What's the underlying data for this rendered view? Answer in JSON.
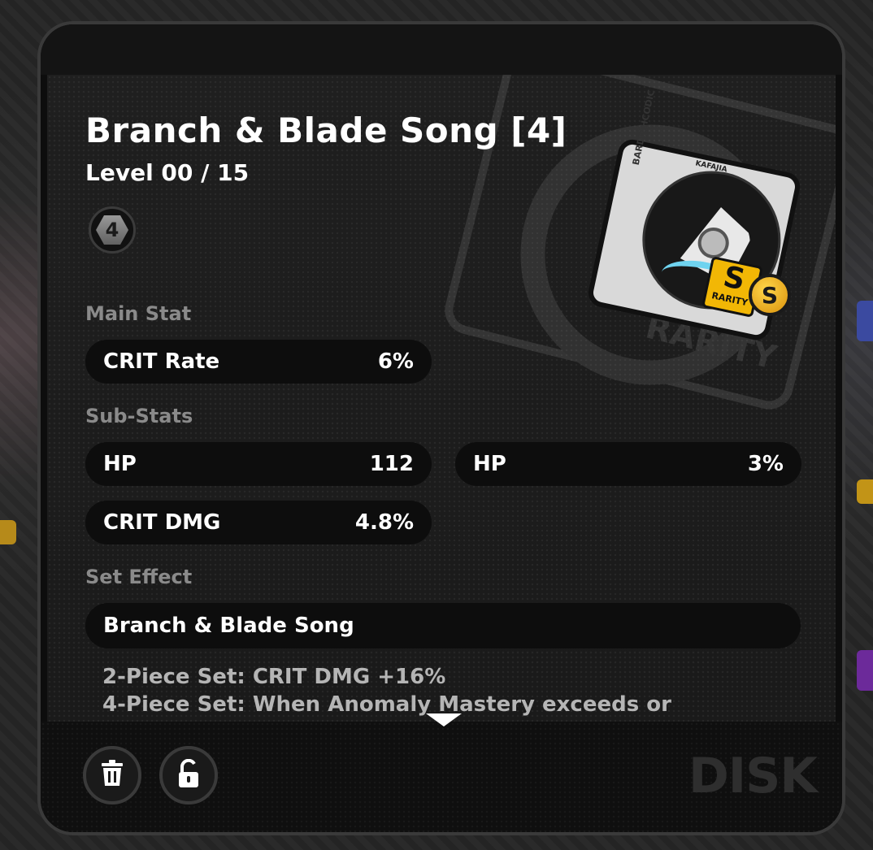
{
  "item": {
    "title": "Branch & Blade Song [4]",
    "level": "Level 00 / 15",
    "slot": "4",
    "rarity": "S"
  },
  "disk_art": {
    "spine_text": "BARDICHCODIC",
    "top_text": "KAFAJIA",
    "rarity_letter": "S",
    "rarity_word": "RARITY"
  },
  "main_stat": {
    "heading": "Main Stat",
    "name": "CRIT Rate",
    "value": "6%"
  },
  "sub_stats": {
    "heading": "Sub-Stats",
    "items": [
      {
        "name": "HP",
        "value": "112"
      },
      {
        "name": "HP",
        "value": "3%"
      },
      {
        "name": "CRIT DMG",
        "value": "4.8%"
      }
    ]
  },
  "set_effect": {
    "heading": "Set Effect",
    "name": "Branch & Blade Song",
    "line1": "2-Piece Set: CRIT DMG +16%",
    "line2": "4-Piece Set: When Anomaly Mastery exceeds or"
  },
  "footer": {
    "category": "DISK",
    "buttons": [
      "trash-icon",
      "unlock-icon"
    ]
  },
  "colors": {
    "accent_gold": "#f2b705",
    "card_bg": "#1a1a1a",
    "pill_bg": "#0d0d0d",
    "muted_text": "#8a8a8a"
  }
}
